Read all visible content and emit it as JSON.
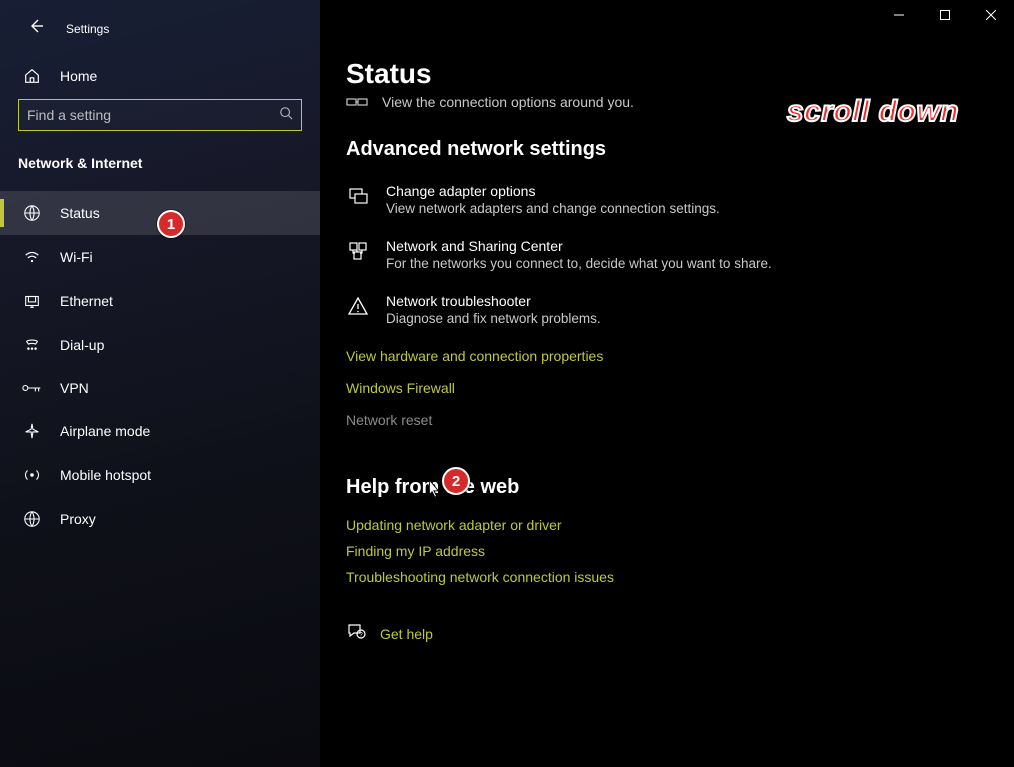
{
  "app": {
    "title": "Settings"
  },
  "search": {
    "placeholder": "Find a setting"
  },
  "home": {
    "label": "Home"
  },
  "category": {
    "title": "Network & Internet"
  },
  "sidebar": {
    "items": [
      {
        "label": "Status",
        "active": true
      },
      {
        "label": "Wi-Fi",
        "active": false
      },
      {
        "label": "Ethernet",
        "active": false
      },
      {
        "label": "Dial-up",
        "active": false
      },
      {
        "label": "VPN",
        "active": false
      },
      {
        "label": "Airplane mode",
        "active": false
      },
      {
        "label": "Mobile hotspot",
        "active": false
      },
      {
        "label": "Proxy",
        "active": false
      }
    ]
  },
  "page": {
    "title": "Status",
    "subtitle": "View the connection options around you."
  },
  "advanced": {
    "title": "Advanced network settings",
    "options": [
      {
        "title": "Change adapter options",
        "desc": "View network adapters and change connection settings."
      },
      {
        "title": "Network and Sharing Center",
        "desc": "For the networks you connect to, decide what you want to share."
      },
      {
        "title": "Network troubleshooter",
        "desc": "Diagnose and fix network problems."
      }
    ],
    "links": {
      "hardware": "View hardware and connection properties",
      "firewall": "Windows Firewall",
      "reset": "Network reset"
    }
  },
  "help": {
    "title": "Help from the web",
    "links": [
      "Updating network adapter or driver",
      "Finding my IP address",
      "Troubleshooting network connection issues"
    ],
    "get_help": "Get help"
  },
  "annotations": {
    "scroll": "scroll down",
    "marker1": "1",
    "marker2": "2"
  }
}
